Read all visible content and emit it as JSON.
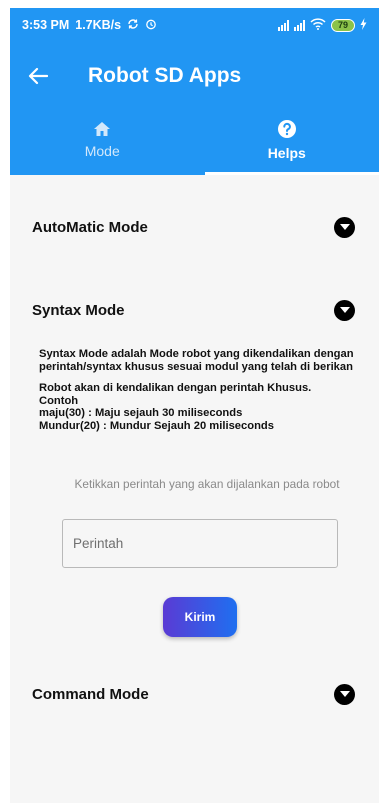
{
  "status_bar": {
    "time": "3:53 PM",
    "speed": "1.7KB/s",
    "battery": "79"
  },
  "app_bar": {
    "title": "Robot SD Apps"
  },
  "tabs": [
    {
      "label": "Mode",
      "icon": "home-icon",
      "active": false
    },
    {
      "label": "Helps",
      "icon": "help-icon",
      "active": true
    }
  ],
  "sections": {
    "automatic": {
      "title": "AutoMatic Mode"
    },
    "syntax": {
      "title": "Syntax Mode",
      "description": "Syntax Mode adalah Mode robot yang dikendalikan dengan perintah/syntax khusus sesuai modul yang telah di berikan",
      "example_lines": [
        "Robot akan di kendalikan dengan perintah Khusus.",
        "Contoh",
        "maju(30) : Maju sejauh 30 miliseconds",
        "Mundur(20) : Mundur Sejauh 20 miliseconds"
      ],
      "hint": "Ketikkan perintah yang akan dijalankan pada robot",
      "input_placeholder": "Perintah",
      "send_label": "Kirim"
    },
    "command": {
      "title": "Command Mode"
    }
  },
  "colors": {
    "primary": "#2196f3",
    "button_gradient_start": "#5a3bd4",
    "button_gradient_end": "#1f6ff0",
    "background": "#f6f6f6"
  }
}
